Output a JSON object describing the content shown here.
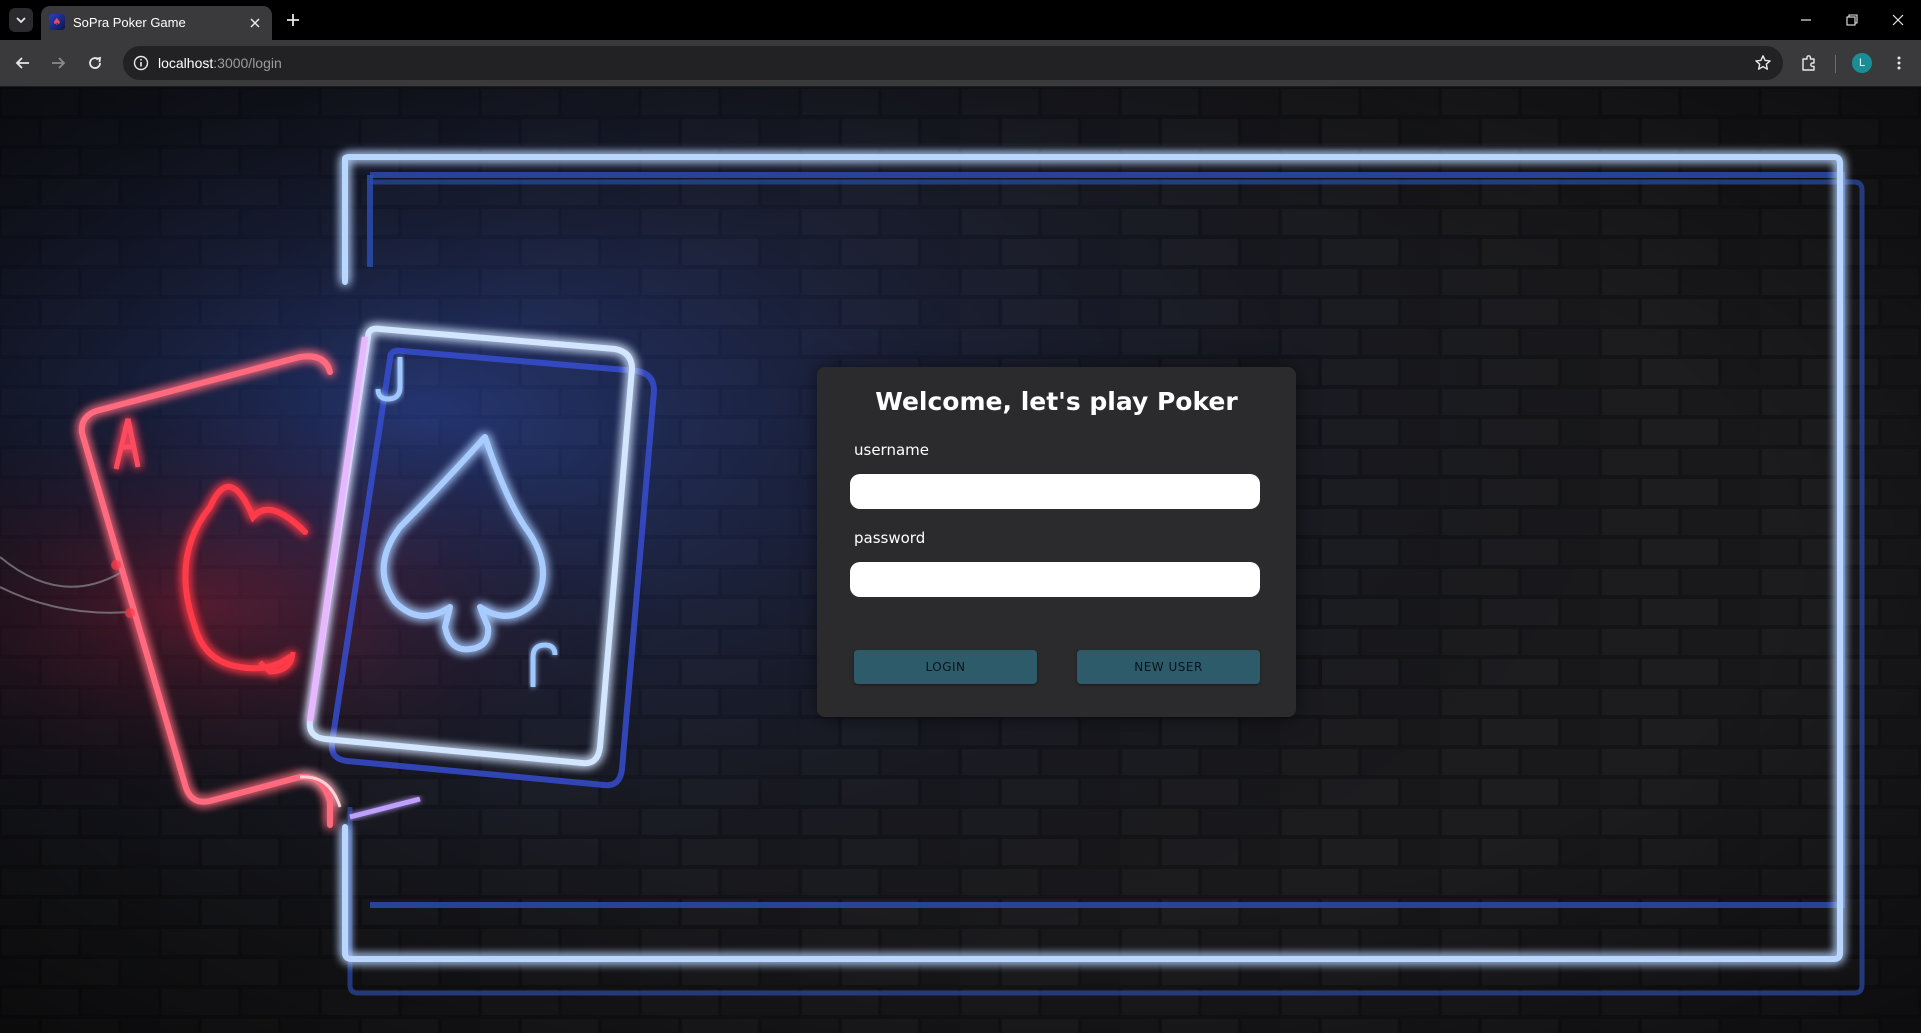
{
  "browser": {
    "tab_title": "SoPra Poker Game",
    "url_host": "localhost",
    "url_path": ":3000/login",
    "profile_initial": "L"
  },
  "login": {
    "title": "Welcome, let's play Poker",
    "username_label": "username",
    "password_label": "password",
    "username_value": "",
    "password_value": "",
    "login_button": "LOGIN",
    "new_user_button": "NEW USER"
  },
  "background": {
    "cards": [
      "A",
      "J"
    ],
    "suit": "spade"
  },
  "colors": {
    "chrome_dark": "#000000",
    "chrome_toolbar": "#3a3a3c",
    "card_background": "#2b2b2d",
    "button_background": "#2e5b69",
    "neon_blue": "#7fb4ff",
    "neon_red": "#ff3a4a"
  }
}
